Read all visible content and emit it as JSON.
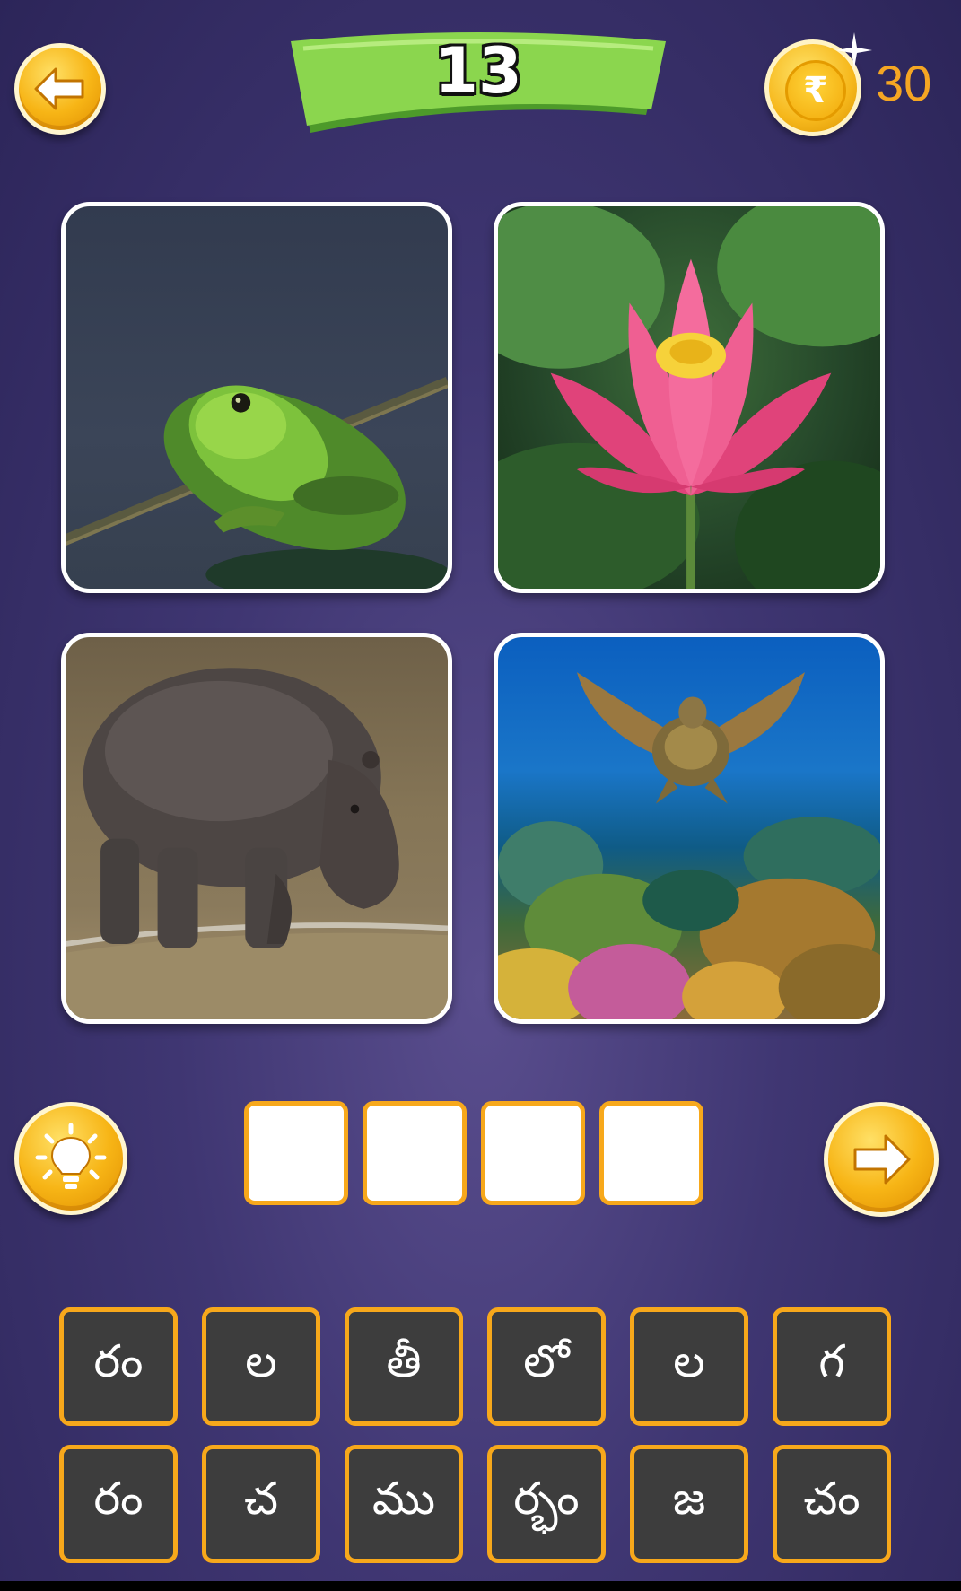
{
  "header": {
    "level": "13",
    "coins": "30",
    "currency_symbol": "₹",
    "back_icon": "arrow-left-icon"
  },
  "puzzle": {
    "images": [
      {
        "subject": "frog"
      },
      {
        "subject": "lotus"
      },
      {
        "subject": "hippopotamus"
      },
      {
        "subject": "sea-turtle"
      }
    ],
    "answer_slots": [
      "",
      "",
      "",
      ""
    ],
    "hint_icon": "lightbulb-icon",
    "next_icon": "arrow-right-icon"
  },
  "keyboard": {
    "row1": [
      "రం",
      "ల",
      "తీ",
      "లో",
      "ల",
      "గ"
    ],
    "row2": [
      "రం",
      "చ",
      "ము",
      "ర్భం",
      "జ",
      "చం"
    ]
  },
  "colors": {
    "accent_orange": "#f7a81b",
    "banner_green": "#8bd64e",
    "key_bg": "#3d3d3d",
    "coin_text": "#f5a623"
  }
}
